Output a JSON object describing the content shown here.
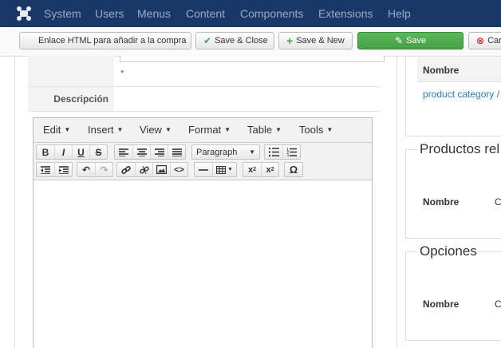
{
  "topbar": {
    "logo_icon": "joomla-logo-icon",
    "menu": [
      "System",
      "Users",
      "Menus",
      "Content",
      "Components",
      "Extensions",
      "Help"
    ]
  },
  "toolbar": {
    "enlace_label": "Enlace HTML para añadir a la compra",
    "save_close_label": "Save & Close",
    "save_new_label": "Save & New",
    "save_label": "Save",
    "cancel_label": "Car",
    "save_color": "#46a046"
  },
  "form": {
    "top_field_note": "*",
    "descripcion_label": "Descripción"
  },
  "editor": {
    "menus": [
      "Edit",
      "Insert",
      "View",
      "Format",
      "Table",
      "Tools"
    ],
    "format_select": "Paragraph"
  },
  "right": {
    "panel1": {
      "col_header": "Nombre",
      "link_text": "product category /"
    },
    "productos": {
      "legend": "Productos rel",
      "col_nombre": "Nombre",
      "col_second": "C"
    },
    "opciones": {
      "legend": "Opciones",
      "col_nombre": "Nombre",
      "col_second": "C"
    }
  }
}
